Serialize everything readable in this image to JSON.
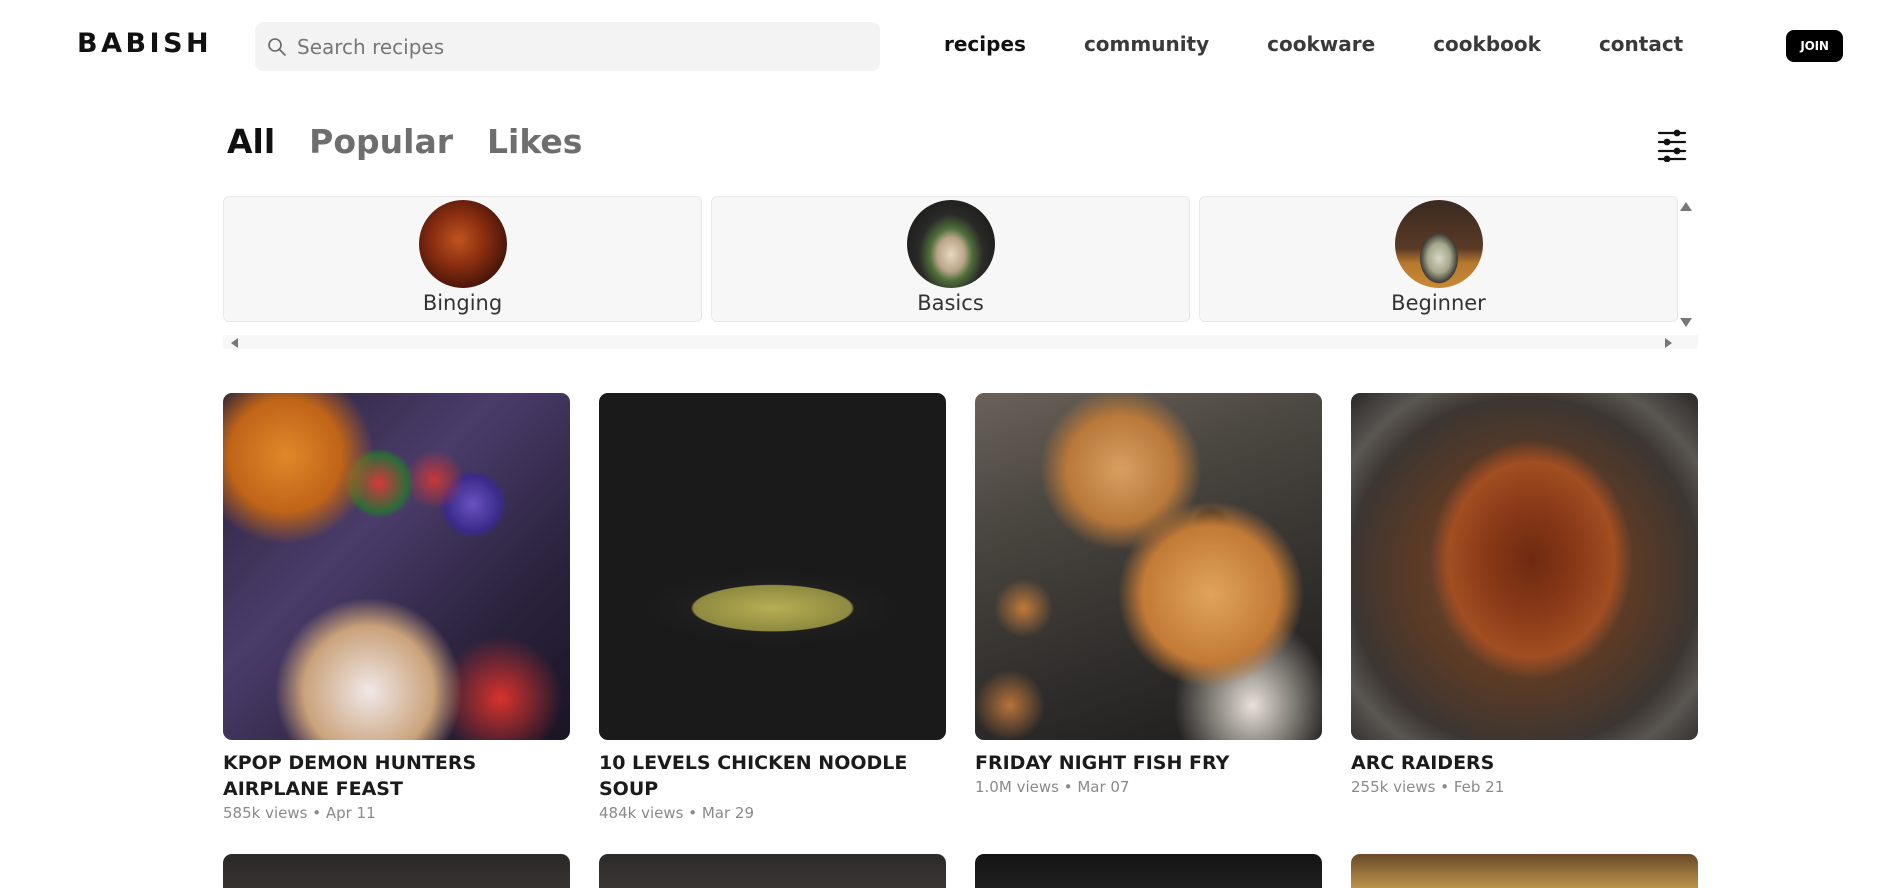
{
  "header": {
    "logo": "BABISH",
    "search_placeholder": "Search recipes",
    "nav": [
      "recipes",
      "community",
      "cookware",
      "cookbook",
      "contact"
    ],
    "active_nav": "recipes",
    "join_label": "JOIN"
  },
  "filters": {
    "tabs": [
      "All",
      "Popular",
      "Likes"
    ],
    "active_tab": "All"
  },
  "categories": [
    {
      "label": "Binging"
    },
    {
      "label": "Basics"
    },
    {
      "label": "Beginner"
    }
  ],
  "recipes": [
    {
      "title": "KPOP DEMON HUNTERS AIRPLANE FEAST",
      "views": "585k views",
      "date": "Apr 11"
    },
    {
      "title": "10 LEVELS CHICKEN NOODLE SOUP",
      "views": "484k views",
      "date": "Mar 29"
    },
    {
      "title": "FRIDAY NIGHT FISH FRY",
      "views": "1.0M views",
      "date": "Mar 07"
    },
    {
      "title": "ARC RAIDERS",
      "views": "255k views",
      "date": "Feb 21"
    }
  ],
  "colors": {
    "accent": "#000000",
    "text": "#111111",
    "muted": "#6e6e6e",
    "meta": "#8a8a8a",
    "panel": "#f7f7f7"
  },
  "icons": {
    "search": "search-icon",
    "filter": "sliders-icon"
  }
}
